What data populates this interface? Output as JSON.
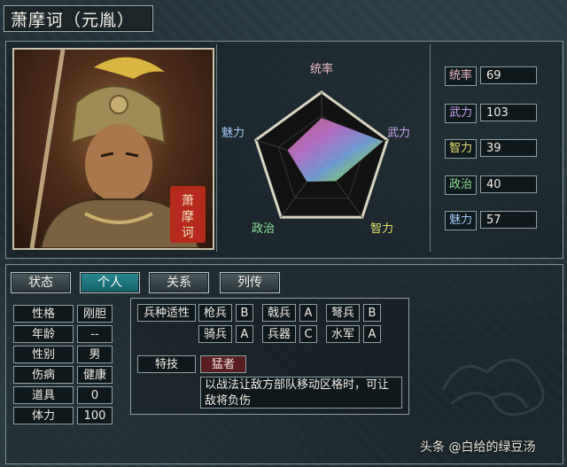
{
  "header": {
    "name": "萧摩诃（元胤）"
  },
  "portrait": {
    "seal_text": "萧摩诃"
  },
  "radar": {
    "labels": [
      "统率",
      "武力",
      "智力",
      "政治",
      "魅力"
    ],
    "max": 110
  },
  "stats": [
    {
      "label": "统率",
      "value": "69",
      "color": "#f3b9c8"
    },
    {
      "label": "武力",
      "value": "103",
      "color": "#c9a3f0"
    },
    {
      "label": "智力",
      "value": "39",
      "color": "#e6e06a"
    },
    {
      "label": "政治",
      "value": "40",
      "color": "#8fe39a"
    },
    {
      "label": "魅力",
      "value": "57",
      "color": "#9ec7f5"
    }
  ],
  "tabs": [
    {
      "label": "状态",
      "active": false
    },
    {
      "label": "个人",
      "active": true
    },
    {
      "label": "关系",
      "active": false
    },
    {
      "label": "列传",
      "active": false
    }
  ],
  "profile": [
    {
      "label": "性格",
      "value": "刚胆"
    },
    {
      "label": "年龄",
      "value": "--"
    },
    {
      "label": "性别",
      "value": "男"
    },
    {
      "label": "伤病",
      "value": "健康"
    },
    {
      "label": "道具",
      "value": "0"
    },
    {
      "label": "体力",
      "value": "100"
    }
  ],
  "aptitude": {
    "title": "兵种适性",
    "rows": [
      [
        {
          "unit": "枪兵",
          "grade": "B"
        },
        {
          "unit": "戟兵",
          "grade": "A"
        },
        {
          "unit": "弩兵",
          "grade": "B"
        }
      ],
      [
        {
          "unit": "骑兵",
          "grade": "A"
        },
        {
          "unit": "兵器",
          "grade": "C"
        },
        {
          "unit": "水军",
          "grade": "A"
        }
      ]
    ]
  },
  "skill": {
    "label": "特技",
    "name": "猛者",
    "description": "以战法让敌方部队移动区格时，可让敌将负伤"
  },
  "watermark": "头条 @白给的绿豆汤"
}
